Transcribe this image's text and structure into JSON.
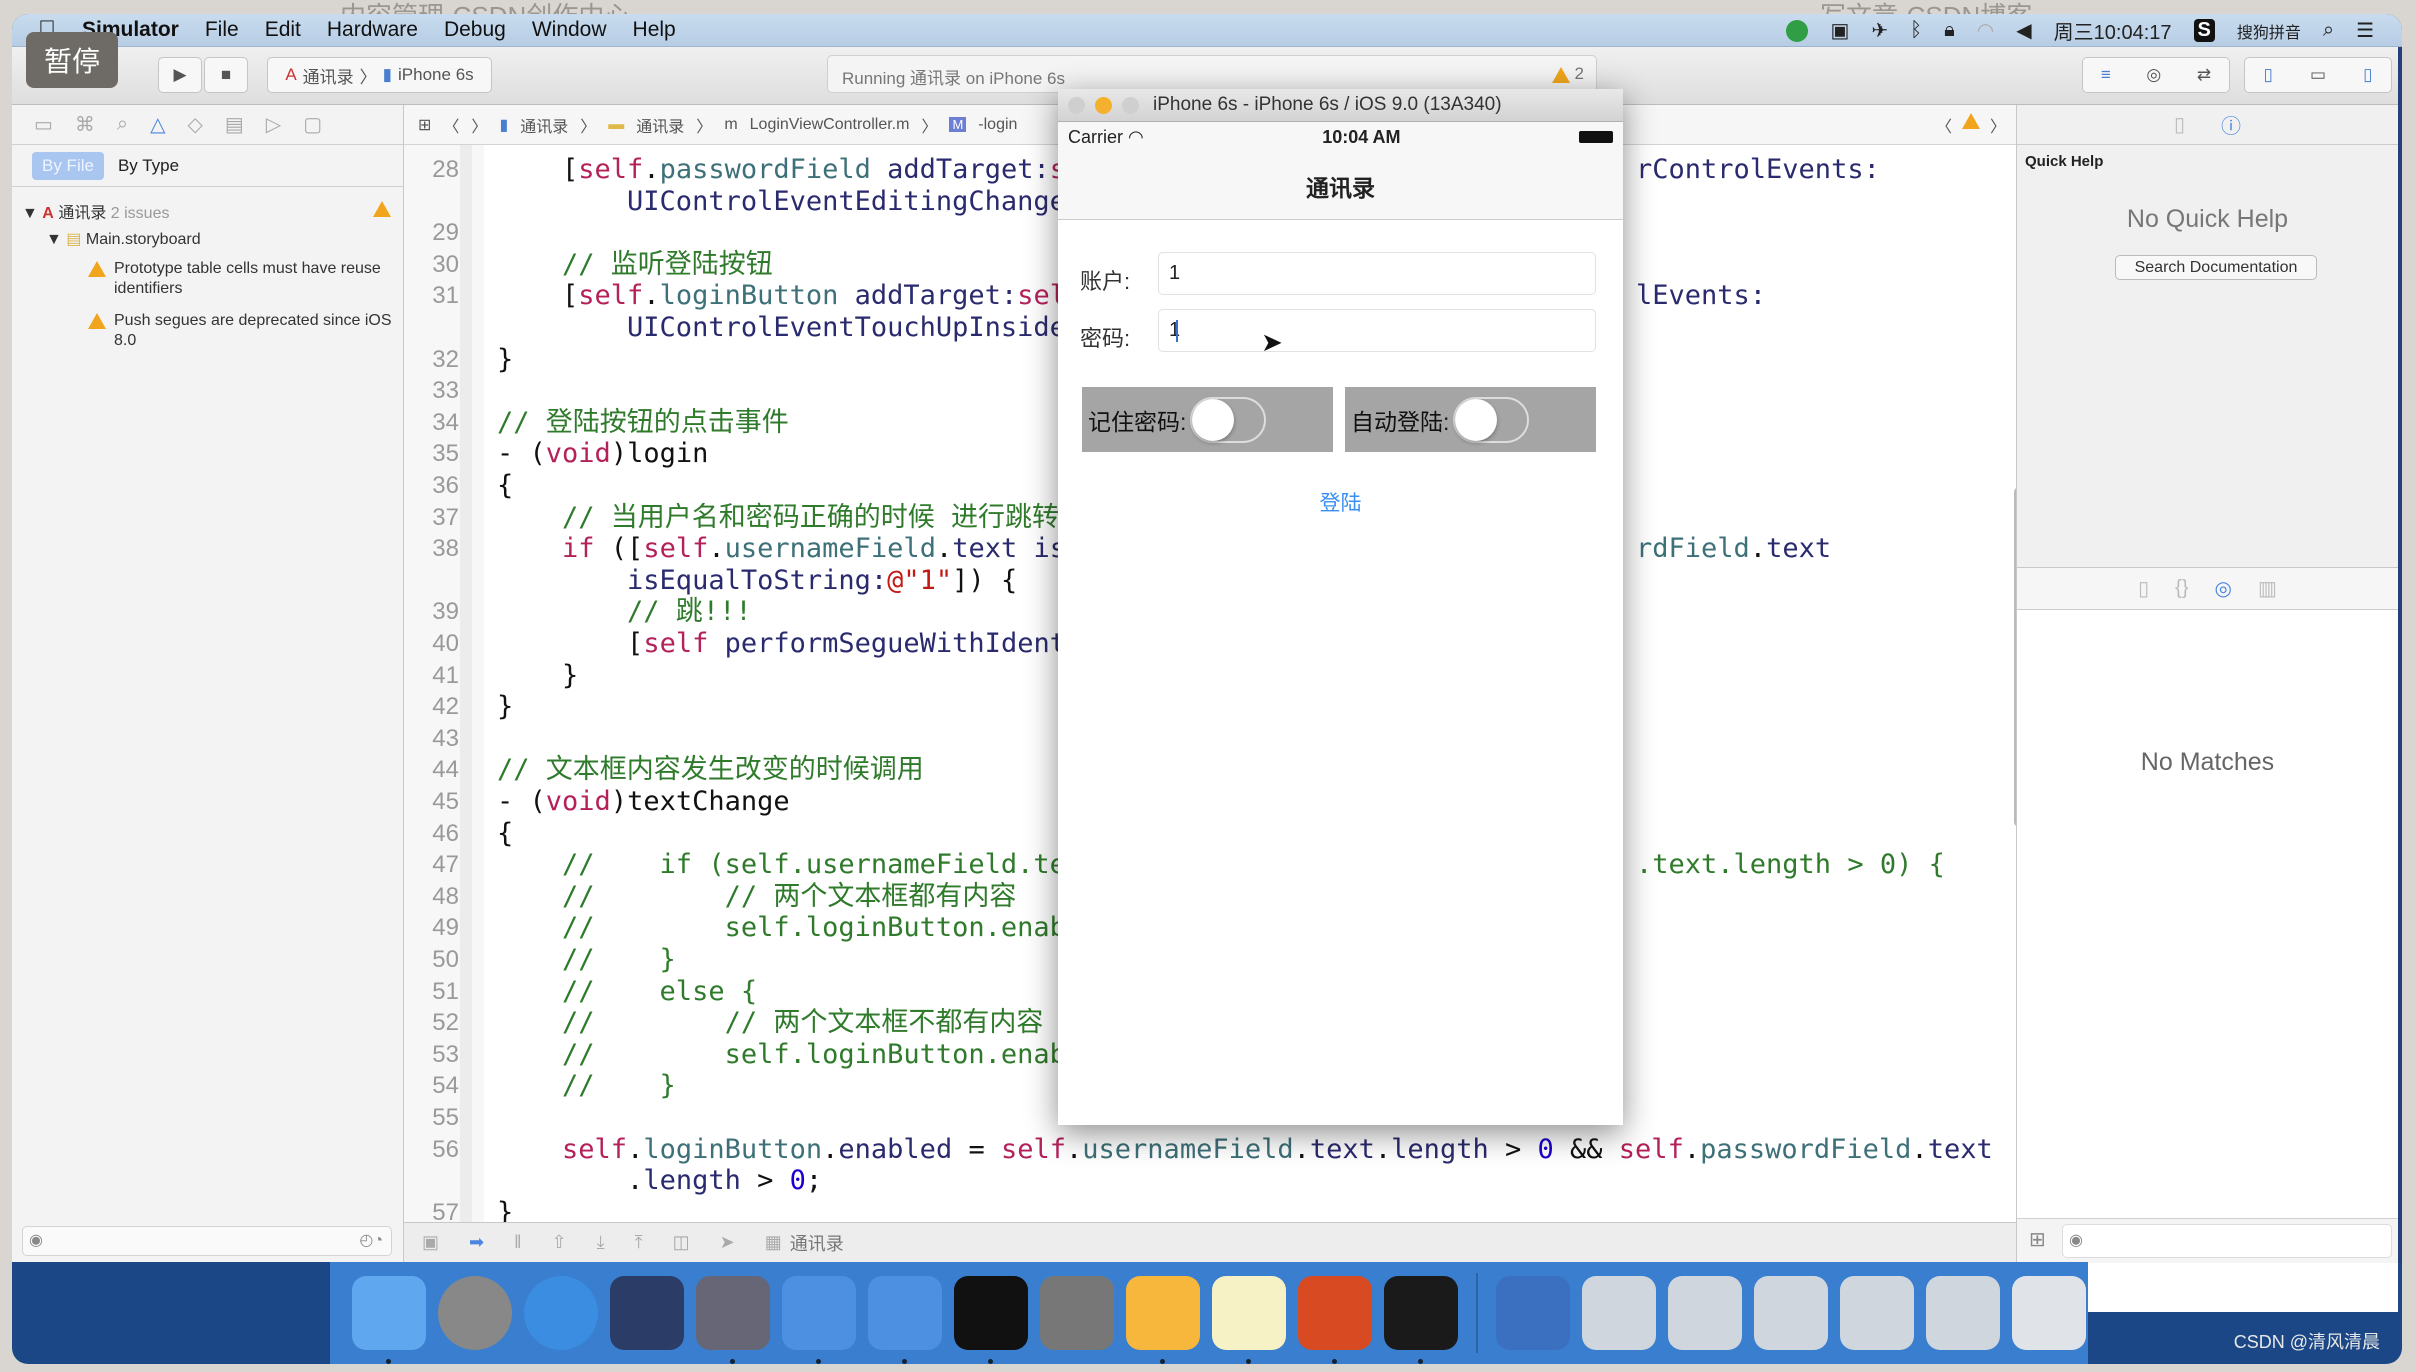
{
  "background_tabs": [
    "内容管理-CSDN创作中心",
    "写文章-CSDN博客"
  ],
  "menubar": {
    "apple": "",
    "items": [
      "Simulator",
      "File",
      "Edit",
      "Hardware",
      "Debug",
      "Window",
      "Help"
    ],
    "clock": "周三10:04:17",
    "ime": "搜狗拼音",
    "status_icons": [
      "record-icon",
      "camera-icon",
      "airplane-icon",
      "bluetooth-icon",
      "lock-icon",
      "wifi-icon",
      "volume-icon"
    ]
  },
  "overlay": {
    "pause": "暂停"
  },
  "toolbar": {
    "scheme": "通讯录",
    "device": "iPhone 6s",
    "activity": "Running 通讯录 on iPhone 6s",
    "warning_count": "2"
  },
  "navigator": {
    "filter_tabs": [
      "By File",
      "By Type"
    ],
    "project": "通讯录",
    "issue_count": "2 issues",
    "file": "Main.storyboard",
    "issues": [
      "Prototype table cells must have reuse identifiers",
      "Push segues are deprecated since iOS 8.0"
    ]
  },
  "jumpbar": [
    "通讯录",
    "通讯录",
    "LoginViewController.m",
    "-login"
  ],
  "editor": {
    "lines": [
      {
        "n": "28",
        "seg": [
          [
            "    [",
            "p"
          ],
          [
            "self",
            "k"
          ],
          [
            ".",
            "p"
          ],
          [
            "passwordField",
            "pr"
          ],
          [
            " addTarget:",
            "m"
          ],
          [
            "s",
            "k"
          ]
        ],
        "right": [
          [
            "rControlEvents:",
            "m"
          ]
        ]
      },
      {
        "n": "",
        "seg": [
          [
            "        UIControlEventEditingChangec",
            "m"
          ]
        ]
      },
      {
        "n": "29",
        "seg": []
      },
      {
        "n": "30",
        "seg": [
          [
            "    // 监听登陆按钮",
            "c"
          ]
        ]
      },
      {
        "n": "31",
        "seg": [
          [
            "    [",
            "p"
          ],
          [
            "self",
            "k"
          ],
          [
            ".",
            "p"
          ],
          [
            "loginButton",
            "pr"
          ],
          [
            " addTarget:",
            "m"
          ],
          [
            "sel",
            "k"
          ]
        ],
        "right": [
          [
            "lEvents:",
            "m"
          ]
        ]
      },
      {
        "n": "",
        "seg": [
          [
            "        UIControlEventTouchUpInside]",
            "m"
          ]
        ]
      },
      {
        "n": "32",
        "seg": [
          [
            "}",
            "p"
          ]
        ]
      },
      {
        "n": "33",
        "seg": []
      },
      {
        "n": "34",
        "seg": [
          [
            "// 登陆按钮的点击事件",
            "c"
          ]
        ]
      },
      {
        "n": "35",
        "seg": [
          [
            "- (",
            "p"
          ],
          [
            "void",
            "k"
          ],
          [
            ")login",
            "p"
          ]
        ]
      },
      {
        "n": "36",
        "seg": [
          [
            "{",
            "p"
          ]
        ]
      },
      {
        "n": "37",
        "seg": [
          [
            "    // 当用户名和密码正确的时候 进行跳转",
            "c"
          ]
        ]
      },
      {
        "n": "38",
        "seg": [
          [
            "    ",
            "p"
          ],
          [
            "if",
            "k"
          ],
          [
            " ([",
            "p"
          ],
          [
            "self",
            "k"
          ],
          [
            ".",
            "p"
          ],
          [
            "usernameField",
            "pr"
          ],
          [
            ".",
            "p"
          ],
          [
            "text",
            "m"
          ],
          [
            " isE",
            "m"
          ]
        ],
        "right": [
          [
            "rdField",
            "pr"
          ],
          [
            ".",
            "p"
          ],
          [
            "text",
            "m"
          ]
        ]
      },
      {
        "n": "",
        "seg": [
          [
            "        isEqualToString:",
            "m"
          ],
          [
            "@\"1\"",
            "s"
          ],
          [
            "]) {",
            "p"
          ]
        ]
      },
      {
        "n": "39",
        "seg": [
          [
            "        // 跳!!!",
            "c"
          ]
        ]
      },
      {
        "n": "40",
        "seg": [
          [
            "        [",
            "p"
          ],
          [
            "self",
            "k"
          ],
          [
            " performSegueWithIdent",
            "m"
          ]
        ]
      },
      {
        "n": "41",
        "seg": [
          [
            "    }",
            "p"
          ]
        ]
      },
      {
        "n": "42",
        "seg": [
          [
            "}",
            "p"
          ]
        ]
      },
      {
        "n": "43",
        "seg": []
      },
      {
        "n": "44",
        "seg": [
          [
            "// 文本框内容发生改变的时候调用",
            "c"
          ]
        ]
      },
      {
        "n": "45",
        "seg": [
          [
            "- (",
            "p"
          ],
          [
            "void",
            "k"
          ],
          [
            ")textChange",
            "p"
          ]
        ]
      },
      {
        "n": "46",
        "seg": [
          [
            "{",
            "p"
          ]
        ]
      },
      {
        "n": "47",
        "seg": [
          [
            "    //    if (self.usernameField.tex",
            "c"
          ]
        ],
        "right": [
          [
            ".text.length > 0) {",
            "c"
          ]
        ]
      },
      {
        "n": "48",
        "seg": [
          [
            "    //        // 两个文本框都有内容",
            "c"
          ]
        ]
      },
      {
        "n": "49",
        "seg": [
          [
            "    //        self.loginButton.enab",
            "c"
          ]
        ]
      },
      {
        "n": "50",
        "seg": [
          [
            "    //    }",
            "c"
          ]
        ]
      },
      {
        "n": "51",
        "seg": [
          [
            "    //    else {",
            "c"
          ]
        ]
      },
      {
        "n": "52",
        "seg": [
          [
            "    //        // 两个文本框不都有内容",
            "c"
          ]
        ]
      },
      {
        "n": "53",
        "seg": [
          [
            "    //        self.loginButton.enab",
            "c"
          ]
        ]
      },
      {
        "n": "54",
        "seg": [
          [
            "    //    }",
            "c"
          ]
        ]
      },
      {
        "n": "55",
        "seg": []
      },
      {
        "n": "56",
        "seg": [
          [
            "    ",
            "p"
          ],
          [
            "self",
            "k"
          ],
          [
            ".",
            "p"
          ],
          [
            "loginButton",
            "pr"
          ],
          [
            ".",
            "p"
          ],
          [
            "enabled",
            "m"
          ],
          [
            " = ",
            "p"
          ],
          [
            "self",
            "k"
          ],
          [
            ".",
            "p"
          ],
          [
            "usernameField",
            "pr"
          ],
          [
            ".",
            "p"
          ],
          [
            "text",
            "m"
          ],
          [
            ".",
            "p"
          ],
          [
            "length",
            "m"
          ],
          [
            " > ",
            "p"
          ],
          [
            "0",
            "n"
          ],
          [
            " && ",
            "p"
          ],
          [
            "self",
            "k"
          ],
          [
            ".",
            "p"
          ],
          [
            "passwordField",
            "pr"
          ],
          [
            ".",
            "p"
          ],
          [
            "text",
            "m"
          ]
        ]
      },
      {
        "n": "",
        "seg": [
          [
            "        .",
            "p"
          ],
          [
            "length",
            "m"
          ],
          [
            " > ",
            "p"
          ],
          [
            "0",
            "n"
          ],
          [
            ";",
            "p"
          ]
        ]
      },
      {
        "n": "57",
        "seg": [
          [
            "}",
            "p"
          ]
        ]
      }
    ]
  },
  "debugbar": {
    "target": "通讯录"
  },
  "simulator": {
    "title": "iPhone 6s - iPhone 6s / iOS 9.0 (13A340)",
    "carrier": "Carrier",
    "time": "10:04 AM",
    "nav_title": "通讯录",
    "account_label": "账户:",
    "account_value": "1",
    "password_label": "密码:",
    "password_value": "1",
    "remember_label": "记住密码:",
    "remember_on": false,
    "autologin_label": "自动登陆:",
    "autologin_on": false,
    "login_button": "登陆",
    "accent": "#3b8ff0"
  },
  "utilities": {
    "quick_help_title": "Quick Help",
    "no_quick_help": "No Quick Help",
    "search_button": "Search Documentation",
    "no_matches": "No Matches"
  },
  "dock": [
    "finder-icon",
    "launchpad-icon",
    "safari-icon",
    "mouse-app-icon",
    "movie-icon",
    "xcode-icon",
    "simulator-icon",
    "terminal-icon",
    "system-preferences-icon",
    "sketch-icon",
    "notes-icon",
    "powerpoint-icon",
    "console-icon",
    "quicktime-icon",
    "window-thumbnail-icon",
    "window-thumbnail-icon",
    "window-thumbnail-icon",
    "window-thumbnail-icon",
    "window-thumbnail-icon",
    "trash-icon"
  ],
  "watermark": "CSDN @清风清晨"
}
